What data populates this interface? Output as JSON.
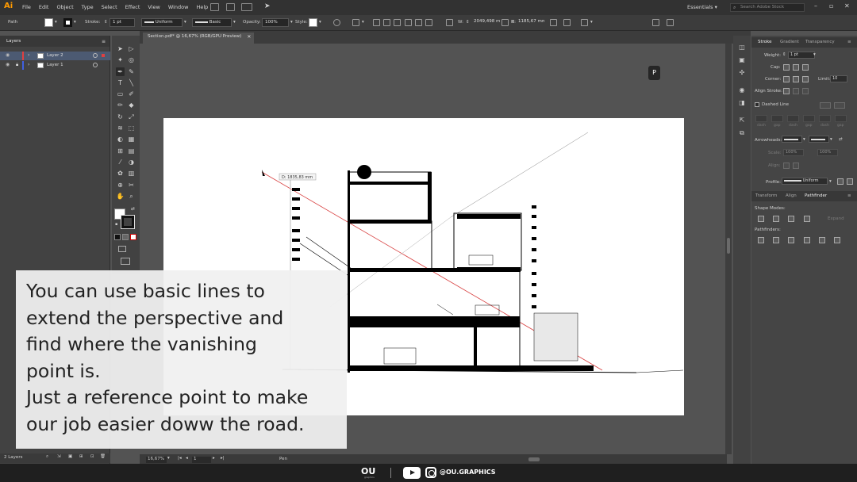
{
  "app": {
    "logo": "Ai",
    "menus": [
      "File",
      "Edit",
      "Object",
      "Type",
      "Select",
      "Effect",
      "View",
      "Window",
      "Help"
    ],
    "workspace": "Essentials",
    "search_placeholder": "Search Adobe Stock"
  },
  "control": {
    "selection": "Path",
    "stroke_label": "Stroke:",
    "stroke_weight": "1 pt",
    "uniform": "Uniform",
    "brush": "Basic",
    "opacity_label": "Opacity:",
    "opacity": "100%",
    "style_label": "Style:",
    "width": "2049,498 mm",
    "height": "1185,67 mm"
  },
  "document": {
    "tab_title": "Section.pdf* @ 16,67% (RGB/GPU Preview)"
  },
  "layers": {
    "title": "Layers",
    "items": [
      {
        "name": "Layer 2",
        "color": "#e04040"
      },
      {
        "name": "Layer 1",
        "color": "#4060e0"
      }
    ],
    "count": "2 Layers"
  },
  "status": {
    "zoom": "16,67%",
    "artboard": "1",
    "tool": "Pen"
  },
  "canvas": {
    "measure": "D: 1835,83 mm",
    "badge": "P"
  },
  "stroke_panel": {
    "tabs": [
      "Stroke",
      "Gradient",
      "Transparency"
    ],
    "weight_label": "Weight:",
    "weight": "1 pt",
    "cap_label": "Cap:",
    "corner_label": "Corner:",
    "limit_label": "Limit:",
    "limit": "10",
    "align_label": "Align Stroke:",
    "dashed_label": "Dashed Line",
    "dash_labels": [
      "dash",
      "gap",
      "dash",
      "gap",
      "dash",
      "gap"
    ],
    "arrowheads_label": "Arrowheads:",
    "scale_label": "Scale:",
    "scale_1": "100%",
    "scale_2": "100%",
    "align_dim": "Align:",
    "profile_label": "Profile:",
    "profile": "Uniform"
  },
  "pathfinder_panel": {
    "tabs": [
      "Transform",
      "Align",
      "Pathfinder"
    ],
    "shape_modes": "Shape Modes:",
    "expand": "Expand",
    "pathfinders": "Pathfinders:"
  },
  "caption": {
    "lines": [
      "You can use basic lines to",
      "extend the perspective and",
      "find where the vanishing",
      "point is.",
      "Just a reference point to make",
      "our job easier doww the road."
    ]
  },
  "footer": {
    "brand": "OU",
    "brand_sub": "graphics",
    "handle": "@OU.GRAPHICS"
  }
}
